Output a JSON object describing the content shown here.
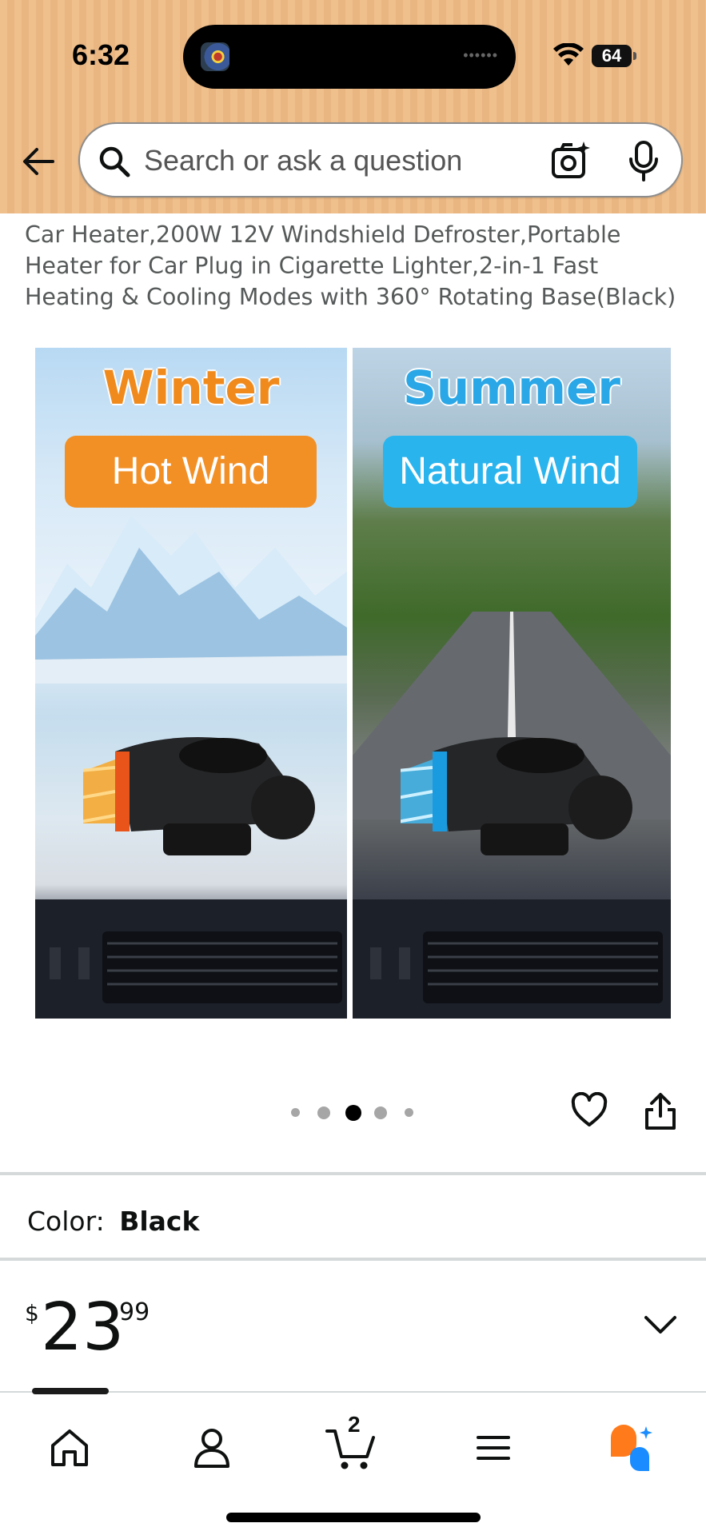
{
  "status_bar": {
    "time": "6:32",
    "battery": "64",
    "wifi_icon": "wifi-icon"
  },
  "search": {
    "placeholder": "Search or ask a question",
    "back_icon": "back-arrow-icon",
    "camera_icon": "camera-search-icon",
    "mic_icon": "microphone-icon"
  },
  "product": {
    "title": "Car Heater,200W 12V Windshield Defroster,Portable Heater for Car Plug in Cigarette Lighter,2-in-1 Fast Heating & Cooling Modes with 360° Rotating Base(Black)",
    "image": {
      "left_heading": "Winter",
      "left_badge": "Hot Wind",
      "right_heading": "Summer",
      "right_badge": "Natural Wind"
    },
    "carousel": {
      "total": 5,
      "active_index": 2
    },
    "color_label": "Color:",
    "color_value": "Black",
    "price": {
      "symbol": "$",
      "whole": "23",
      "fraction": "99"
    }
  },
  "bottom_nav": {
    "items": [
      "home-icon",
      "account-icon",
      "cart-icon",
      "menu-icon",
      "rufus-ai-icon"
    ],
    "cart_count": "2"
  },
  "colors": {
    "header_bg": "#efbf8c",
    "text_primary": "#0f1111",
    "text_secondary": "#565959",
    "winter_orange": "#f29026",
    "summer_blue": "#2ab4ee",
    "rufus_orange": "#ff7a1a",
    "rufus_blue": "#1a8cff"
  }
}
